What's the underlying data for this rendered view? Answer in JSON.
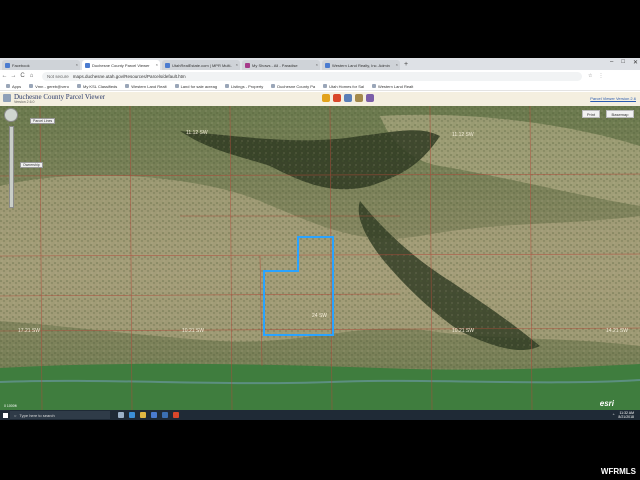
{
  "browser": {
    "tabs": [
      {
        "label": "Facebook",
        "active": false
      },
      {
        "label": "Duchesne County Parcel Viewer",
        "active": true
      },
      {
        "label": "UtahRealEstate.com | MPR Multi-",
        "active": false
      },
      {
        "label": "My Shows - All - Paradise",
        "active": false
      },
      {
        "label": "Western Land Realty, Inc. Admin",
        "active": false
      }
    ],
    "new_tab": "+",
    "window_controls": [
      "–",
      "□",
      "✕"
    ],
    "nav": {
      "back": "←",
      "forward": "→",
      "reload": "C",
      "home": "⌂"
    },
    "address": {
      "security": "Not secure",
      "url": "maps.duchesne.utah.gov/Resources/Parcels/default.htm"
    },
    "bookmarks": [
      "Apps",
      "Vmn - gereb@vero",
      "My KSL Classifieds",
      "Western Land Realt",
      "Land for sale acreag",
      "Listings - Property",
      "Duchesne County Pa",
      "Utah Homes for Sal",
      "Western Land Realt"
    ]
  },
  "app": {
    "title": "Duchesne County Parcel Viewer",
    "version": "Version 2.6.0",
    "link": "Parcel Viewer Version 2.6",
    "map_buttons": {
      "left": "Parcel Lines",
      "left2": "Ownership",
      "print": "Print",
      "basemap": "Basemap"
    }
  },
  "map": {
    "labels": [
      "11.12 SW",
      "11.12 SW",
      "24 SW",
      "17.21 SW",
      "10.21 SW",
      "10.21 SW",
      "14.21 SW"
    ],
    "esri": "esri",
    "scale": "0     1000ft"
  },
  "taskbar": {
    "search_placeholder": "Type here to search",
    "time": "11:32 AM",
    "date": "8/21/2018"
  },
  "watermark": "WFRMLS",
  "colors": {
    "parcel_highlight": "#2aa3ff",
    "parcel_lines": "#b04a3a",
    "taskbar": "#1f2a36"
  },
  "icons": [
    "search-icon",
    "windows-start-icon",
    "edge-icon",
    "chrome-icon",
    "file-explorer-icon",
    "store-icon",
    "mail-icon"
  ]
}
